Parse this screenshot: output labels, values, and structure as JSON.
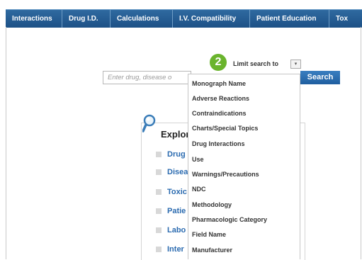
{
  "nav": {
    "tabs": [
      "Interactions",
      "Drug I.D.",
      "Calculations",
      "I.V. Compatibility",
      "Patient Education",
      "Tox"
    ]
  },
  "badge": {
    "number": "2"
  },
  "limit": {
    "label": "Limit search to",
    "arrow": "▾"
  },
  "search": {
    "placeholder": "Enter drug, disease o",
    "button": "Search"
  },
  "explore": {
    "title": "Explor",
    "items": [
      "Drug",
      "Disea",
      "Toxic",
      "Patie",
      "Labo",
      "Inter"
    ]
  },
  "dropdown": {
    "options": [
      "Monograph Name",
      "Adverse Reactions",
      "Contraindications",
      "Charts/Special Topics",
      "Drug Interactions",
      "Use",
      "Warnings/Precautions",
      "NDC",
      "Methodology",
      "Pharmacologic Category",
      "Field Name",
      "Manufacturer"
    ]
  },
  "colors": {
    "nav_blue": "#1d5186",
    "badge_green": "#6ab42d",
    "link_blue": "#2b6bb0"
  }
}
